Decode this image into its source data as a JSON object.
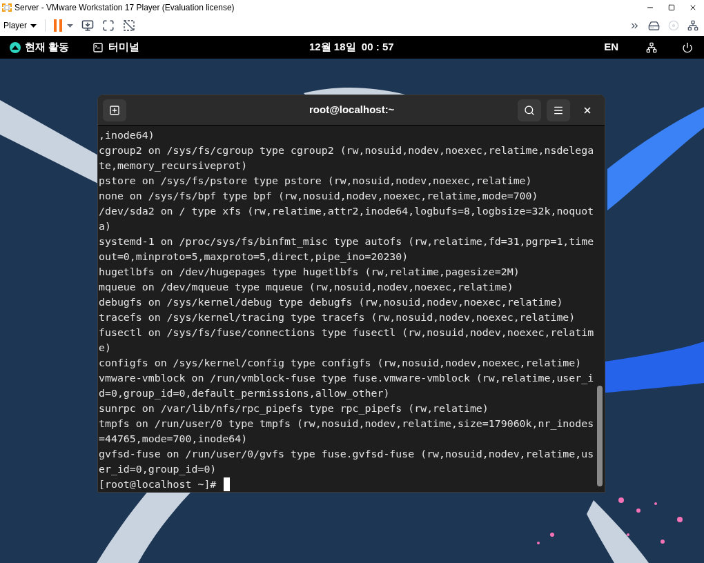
{
  "window": {
    "title": "Server - VMware Workstation 17 Player (Evaluation license)"
  },
  "toolbar": {
    "player_menu": "Player"
  },
  "top_bar": {
    "activities": "현재 활동",
    "app": "터미널",
    "clock": "12월 18일  00 : 57",
    "language": "EN"
  },
  "terminal": {
    "title": "root@localhost:~",
    "lines": [
      ",inode64)",
      "cgroup2 on /sys/fs/cgroup type cgroup2 (rw,nosuid,nodev,noexec,relatime,nsdelega",
      "te,memory_recursiveprot)",
      "pstore on /sys/fs/pstore type pstore (rw,nosuid,nodev,noexec,relatime)",
      "none on /sys/fs/bpf type bpf (rw,nosuid,nodev,noexec,relatime,mode=700)",
      "/dev/sda2 on / type xfs (rw,relatime,attr2,inode64,logbufs=8,logbsize=32k,noquot",
      "a)",
      "systemd-1 on /proc/sys/fs/binfmt_misc type autofs (rw,relatime,fd=31,pgrp=1,time",
      "out=0,minproto=5,maxproto=5,direct,pipe_ino=20230)",
      "hugetlbfs on /dev/hugepages type hugetlbfs (rw,relatime,pagesize=2M)",
      "mqueue on /dev/mqueue type mqueue (rw,nosuid,nodev,noexec,relatime)",
      "debugfs on /sys/kernel/debug type debugfs (rw,nosuid,nodev,noexec,relatime)",
      "tracefs on /sys/kernel/tracing type tracefs (rw,nosuid,nodev,noexec,relatime)",
      "fusectl on /sys/fs/fuse/connections type fusectl (rw,nosuid,nodev,noexec,relatim",
      "e)",
      "configfs on /sys/kernel/config type configfs (rw,nosuid,nodev,noexec,relatime)",
      "vmware-vmblock on /run/vmblock-fuse type fuse.vmware-vmblock (rw,relatime,user_i",
      "d=0,group_id=0,default_permissions,allow_other)",
      "sunrpc on /var/lib/nfs/rpc_pipefs type rpc_pipefs (rw,relatime)",
      "tmpfs on /run/user/0 type tmpfs (rw,nosuid,nodev,relatime,size=179060k,nr_inodes",
      "=44765,mode=700,inode64)",
      "gvfsd-fuse on /run/user/0/gvfs type fuse.gvfsd-fuse (rw,nosuid,nodev,relatime,us",
      "er_id=0,group_id=0)"
    ],
    "prompt": "[root@localhost ~]#"
  }
}
